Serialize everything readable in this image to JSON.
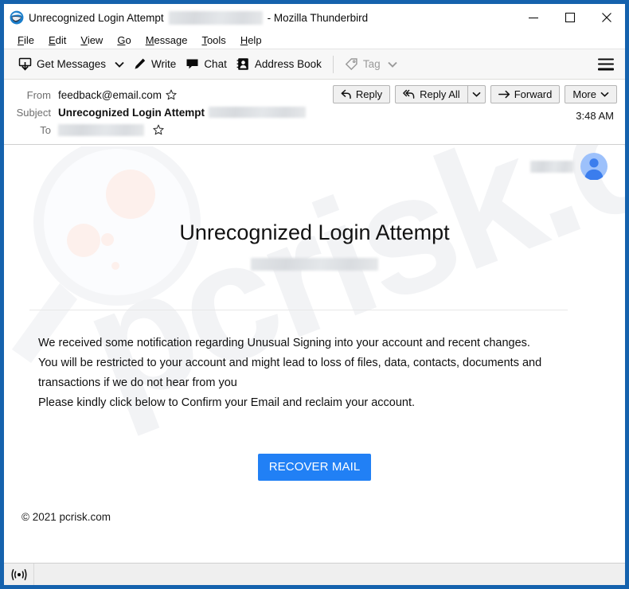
{
  "window": {
    "app_name": "Mozilla Thunderbird",
    "title_prefix": "Unrecognized Login Attempt",
    "title_suffix": "- Mozilla Thunderbird",
    "border_color": "#1562ad",
    "app_icon": "thunderbird-icon",
    "controls": [
      {
        "name": "minimize-button",
        "glyph": "minimize-icon"
      },
      {
        "name": "maximize-button",
        "glyph": "maximize-icon"
      },
      {
        "name": "close-button",
        "glyph": "close-icon"
      }
    ]
  },
  "menubar": {
    "items": [
      {
        "key": "F",
        "rest": "ile"
      },
      {
        "key": "E",
        "rest": "dit"
      },
      {
        "key": "V",
        "rest": "iew"
      },
      {
        "key": "G",
        "rest": "o"
      },
      {
        "key": "M",
        "rest": "essage"
      },
      {
        "key": "T",
        "rest": "ools"
      },
      {
        "key": "H",
        "rest": "elp"
      }
    ]
  },
  "toolbar": {
    "get_messages_label": "Get Messages",
    "get_messages_icon": "download-inbox-icon",
    "get_messages_caret": "chevron-down-icon",
    "write_label": "Write",
    "write_icon": "pencil-icon",
    "chat_label": "Chat",
    "chat_icon": "speech-bubble-icon",
    "address_book_label": "Address Book",
    "address_book_icon": "contact-card-icon",
    "tag_label": "Tag",
    "tag_icon": "tag-icon",
    "tag_caret": "chevron-down-icon",
    "tag_disabled": true,
    "menu_icon": "hamburger-menu-icon"
  },
  "message_header": {
    "from_label": "From",
    "from_value": "feedback@email.com",
    "from_star": "star-outline-icon",
    "subject_label": "Subject",
    "subject_value": "Unrecognized Login Attempt",
    "subject_redacted": true,
    "to_label": "To",
    "to_redacted": true,
    "to_star": "star-outline-icon",
    "time": "3:48 AM",
    "actions": {
      "reply_label": "Reply",
      "reply_icon": "reply-arrow-icon",
      "reply_all_label": "Reply All",
      "reply_all_icon": "reply-all-arrow-icon",
      "reply_all_caret": "chevron-down-icon",
      "forward_label": "Forward",
      "forward_icon": "forward-arrow-icon",
      "more_label": "More",
      "more_caret": "chevron-down-icon"
    }
  },
  "email": {
    "avatar_icon": "user-avatar-icon",
    "avatar_name_redacted": true,
    "heading": "Unrecognized Login Attempt",
    "subheading_redacted": true,
    "paragraphs": [
      "We received some notification regarding Unusual Signing into your account and recent changes.",
      "You will be restricted to your account and might lead to loss of files, data, contacts, documents and transactions if we do not hear from you",
      "Please kindly click below to Confirm your Email and reclaim your account."
    ],
    "cta_label": "RECOVER MAIL",
    "cta_color": "#2180f5",
    "footer": "© 2021 pcrisk.com",
    "watermark_text": "pcrisk.com",
    "watermark_icon": "magnifying-glass-watermark"
  },
  "statusbar": {
    "icon": "broadcast-signal-icon",
    "text": ""
  }
}
